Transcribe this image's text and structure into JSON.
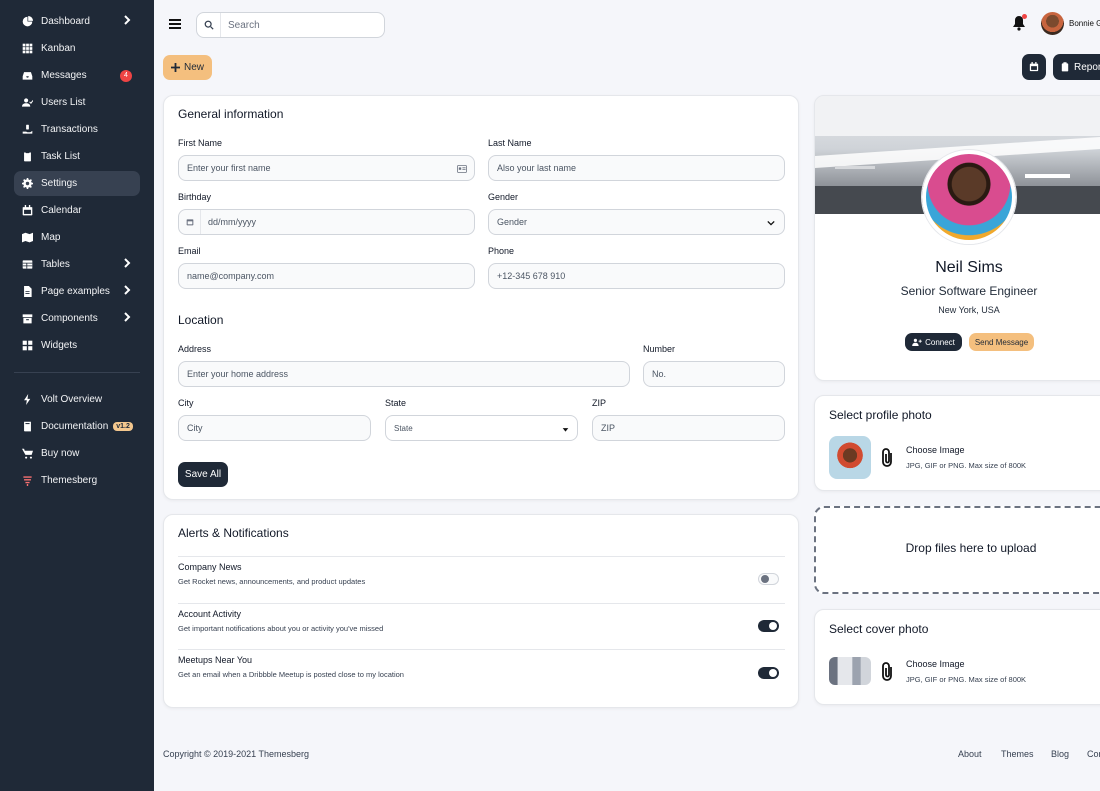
{
  "sidebar": {
    "items": [
      {
        "label": "Dashboard",
        "icon": "pie-chart-icon",
        "chevron": true
      },
      {
        "label": "Kanban",
        "icon": "grid-icon"
      },
      {
        "label": "Messages",
        "icon": "inbox-icon",
        "badge": "4"
      },
      {
        "label": "Users List",
        "icon": "user-check-icon"
      },
      {
        "label": "Transactions",
        "icon": "hand-cash-icon"
      },
      {
        "label": "Task List",
        "icon": "clipboard-icon"
      },
      {
        "label": "Settings",
        "icon": "gear-icon",
        "active": true
      },
      {
        "label": "Calendar",
        "icon": "calendar-icon"
      },
      {
        "label": "Map",
        "icon": "map-icon"
      },
      {
        "label": "Tables",
        "icon": "table-icon",
        "chevron": true
      },
      {
        "label": "Page examples",
        "icon": "document-icon",
        "chevron": true
      },
      {
        "label": "Components",
        "icon": "archive-icon",
        "chevron": true
      },
      {
        "label": "Widgets",
        "icon": "widgets-icon"
      }
    ],
    "secondary": [
      {
        "label": "Volt Overview",
        "icon": "lightning-icon"
      },
      {
        "label": "Documentation",
        "icon": "book-icon",
        "badge": "v1.2"
      },
      {
        "label": "Buy now",
        "icon": "cart-icon"
      },
      {
        "label": "Themesberg",
        "icon": "themesberg-logo-icon"
      }
    ]
  },
  "topbar": {
    "search_placeholder": "Search",
    "username": "Bonnie G"
  },
  "actions": {
    "new_label": "New",
    "report_label": "Report"
  },
  "general": {
    "title": "General information",
    "first_name_label": "First Name",
    "first_name_placeholder": "Enter your first name",
    "last_name_label": "Last Name",
    "last_name_placeholder": "Also your last name",
    "birthday_label": "Birthday",
    "birthday_placeholder": "dd/mm/yyyy",
    "gender_label": "Gender",
    "gender_value": "Gender",
    "email_label": "Email",
    "email_placeholder": "name@company.com",
    "phone_label": "Phone",
    "phone_placeholder": "+12-345 678 910",
    "location_title": "Location",
    "address_label": "Address",
    "address_placeholder": "Enter your home address",
    "number_label": "Number",
    "number_placeholder": "No.",
    "city_label": "City",
    "city_placeholder": "City",
    "state_label": "State",
    "state_value": "State",
    "zip_label": "ZIP",
    "zip_placeholder": "ZIP",
    "save_label": "Save All"
  },
  "alerts": {
    "title": "Alerts & Notifications",
    "rows": [
      {
        "title": "Company News",
        "desc": "Get Rocket news, announcements, and product updates",
        "on": false
      },
      {
        "title": "Account Activity",
        "desc": "Get important notifications about you or activity you've missed",
        "on": true
      },
      {
        "title": "Meetups Near You",
        "desc": "Get an email when a Dribbble Meetup is posted close to my location",
        "on": true
      }
    ]
  },
  "profile": {
    "name": "Neil Sims",
    "role": "Senior Software Engineer",
    "location": "New York, USA",
    "connect_label": "Connect",
    "message_label": "Send Message"
  },
  "profile_photo": {
    "title": "Select profile photo",
    "choose": "Choose Image",
    "hint": "JPG, GIF or PNG. Max size of 800K"
  },
  "dropzone": {
    "text": "Drop files here to upload"
  },
  "cover_photo": {
    "title": "Select cover photo",
    "choose": "Choose Image",
    "hint": "JPG, GIF or PNG. Max size of 800K"
  },
  "footer": {
    "copyright": "Copyright © 2019-2021 Themesberg",
    "links": [
      "About",
      "Themes",
      "Blog",
      "Contact"
    ]
  }
}
